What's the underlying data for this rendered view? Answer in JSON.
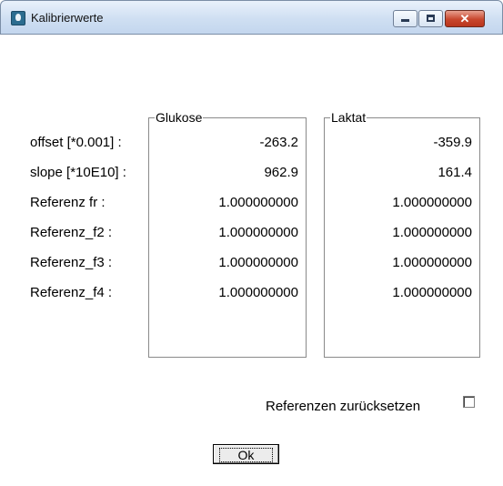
{
  "window": {
    "title": "Kalibrierwerte",
    "close_glyph": "✕"
  },
  "rows": [
    {
      "label": "offset [*0.001] :",
      "glukose": "-263.2",
      "laktat": "-359.9"
    },
    {
      "label": "slope [*10E10] :",
      "glukose": "962.9",
      "laktat": "161.4"
    },
    {
      "label": "Referenz fr :",
      "glukose": "1.000000000",
      "laktat": "1.000000000"
    },
    {
      "label": "Referenz_f2 :",
      "glukose": "1.000000000",
      "laktat": "1.000000000"
    },
    {
      "label": "Referenz_f3 :",
      "glukose": "1.000000000",
      "laktat": "1.000000000"
    },
    {
      "label": "Referenz_f4 :",
      "glukose": "1.000000000",
      "laktat": "1.000000000"
    }
  ],
  "groups": {
    "glukose_title": "Glukose",
    "laktat_title": "Laktat"
  },
  "reset": {
    "label": "Referenzen zurücksetzen",
    "checked": false
  },
  "ok_label": "Ok"
}
